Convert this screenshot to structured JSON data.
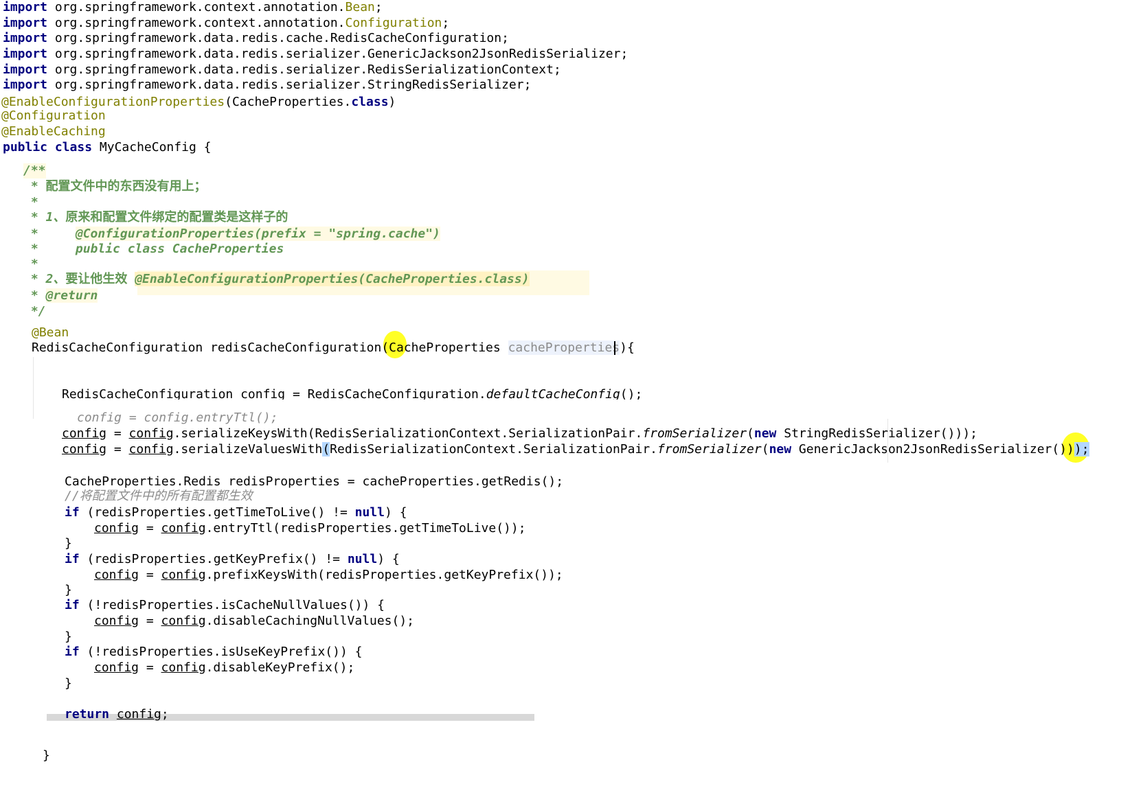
{
  "imports": [
    {
      "kw": "import",
      "pkg": "org.springframework.context.annotation.",
      "cls": "Bean",
      "end": ";"
    },
    {
      "kw": "import",
      "pkg": "org.springframework.context.annotation.",
      "cls": "Configuration",
      "end": ";"
    },
    {
      "kw": "import",
      "pkg": "org.springframework.data.redis.cache.RedisCacheConfiguration;",
      "cls": "",
      "end": ""
    },
    {
      "kw": "import",
      "pkg": "org.springframework.data.redis.serializer.GenericJackson2JsonRedisSerializer;",
      "cls": "",
      "end": ""
    },
    {
      "kw": "import",
      "pkg": "org.springframework.data.redis.serializer.RedisSerializationContext;",
      "cls": "",
      "end": ""
    },
    {
      "kw": "import",
      "pkg": "org.springframework.data.redis.serializer.StringRedisSerializer;",
      "cls": "",
      "end": ""
    }
  ],
  "annotations": {
    "enable_config_props": "@EnableConfigurationProperties",
    "enable_config_props_arg": "(CacheProperties.",
    "class_kw": "class",
    "close_paren": ")",
    "configuration": "@Configuration",
    "enable_caching": "@EnableCaching"
  },
  "class_decl": {
    "public": "public",
    "class": "class",
    "name": " MyCacheConfig {"
  },
  "javadoc": {
    "open": "/**",
    "line1_star": " * ",
    "line1_text": "配置文件中的东西没有用上；",
    "line2": " *",
    "line3_star": " * 1、",
    "line3_text": "原来和配置文件绑定的配置类是这样子的",
    "line4_star": " *",
    "line4_code": "@ConfigurationProperties(prefix = \"spring.cache\")",
    "line5_star": " *",
    "line5_code": "public class CacheProperties",
    "line6": " *",
    "line7_star": " * 2、",
    "line7_text": "要让他生效",
    "line7_code": "@EnableConfigurationProperties(CacheProperties.class)",
    "line8_star": " * ",
    "line8_tag": "@return",
    "close": " */"
  },
  "method": {
    "bean": "@Bean",
    "sig_pre": "RedisCacheConfiguration redisCacheConfiguration(",
    "sig_type": "CacheProperties",
    "sig_param": "cacheProperties",
    "sig_post": "){"
  },
  "body": {
    "l1_pre": "RedisCacheConfiguration config = RedisCacheConfiguration.",
    "l1_method": "defaultCacheConfig",
    "l1_post": "();",
    "l2_commented": "config = config.entryTtl();",
    "l3_a": "config",
    "l3_b": " = ",
    "l3_c": "config",
    "l3_d": ".serializeKeysWith(RedisSerializationContext.SerializationPair.",
    "l3_e": "fromSerializer",
    "l3_f": "(",
    "l3_new": "new",
    "l3_g": " StringRedisSerializer()));",
    "l4_a": "config",
    "l4_b": " = ",
    "l4_c": "config",
    "l4_d": ".serializeValuesWith",
    "l4_paren": "(",
    "l4_e": "RedisSerializationContext.SerializationPair.",
    "l4_f": "fromSerializer",
    "l4_g": "(",
    "l4_new": "new",
    "l4_h": " GenericJackson2JsonRedisSerializer())",
    "l4_end": ");",
    "l5": "CacheProperties.Redis redisProperties = cacheProperties.getRedis();",
    "l6_comment": "//将配置文件中的所有配置都生效",
    "if1_kw": "if",
    "if1_cond": " (redisProperties.getTimeToLive() != ",
    "null_kw": "null",
    "if1_end": ") {",
    "if1_body_rest": ".entryTtl(redisProperties.getTimeToLive());",
    "if2_cond": " (redisProperties.getKeyPrefix() != ",
    "if2_body_rest": ".prefixKeysWith(redisProperties.getKeyPrefix());",
    "if3_cond": " (!redisProperties.isCacheNullValues()) {",
    "if3_body_rest": ".disableCachingNullValues();",
    "if4_cond": " (!redisProperties.isUseKeyPrefix()) {",
    "if4_body_rest": ".disableKeyPrefix();",
    "close_brace": "}",
    "ret_kw": "return",
    "ret_val": "config",
    "ret_end": ";",
    "cfg": "config",
    "eq": " = "
  },
  "end_brace": "}",
  "colors": {
    "keyword": "#000080",
    "annotation": "#808000",
    "doc_comment": "#629755",
    "highlight": "#ffff00"
  }
}
